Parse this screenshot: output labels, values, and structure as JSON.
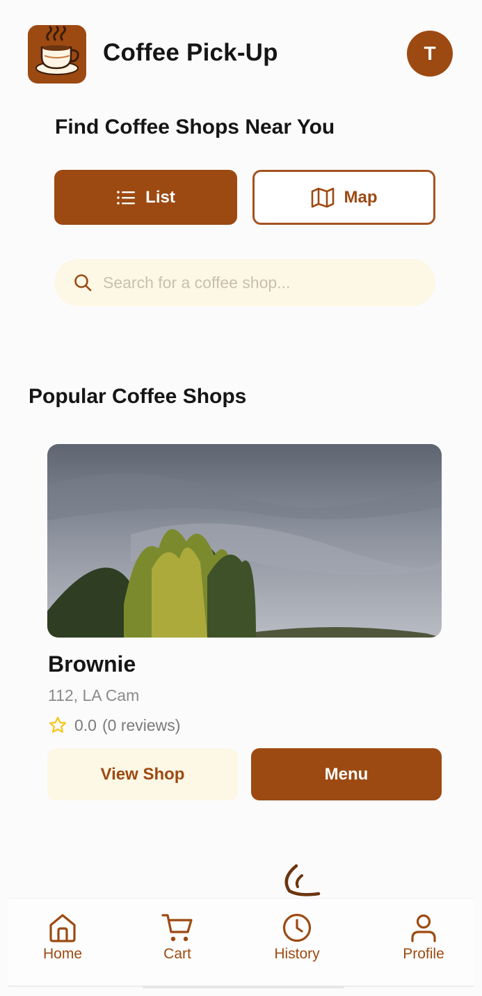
{
  "app": {
    "title": "Coffee Pick-Up",
    "avatar_initial": "T"
  },
  "page": {
    "title": "Find Coffee Shops Near You"
  },
  "view_toggle": {
    "list_label": "List",
    "map_label": "Map",
    "active": "List"
  },
  "search": {
    "placeholder": "Search for a coffee shop...",
    "value": ""
  },
  "popular": {
    "title": "Popular Coffee Shops",
    "shops": [
      {
        "name": "Brownie",
        "address": "112, LA Cam",
        "rating": "0.0",
        "reviews": "(0 reviews)",
        "view_label": "View Shop",
        "menu_label": "Menu"
      }
    ]
  },
  "tabbar": {
    "items": [
      {
        "label": "Home",
        "icon": "home-icon"
      },
      {
        "label": "Cart",
        "icon": "cart-icon"
      },
      {
        "label": "History",
        "icon": "clock-icon"
      },
      {
        "label": "Profile",
        "icon": "user-icon"
      }
    ]
  },
  "colors": {
    "accent": "#9c4a12",
    "cream": "#fdf7e6",
    "background": "#fcfbfc",
    "star": "#f5c518"
  }
}
